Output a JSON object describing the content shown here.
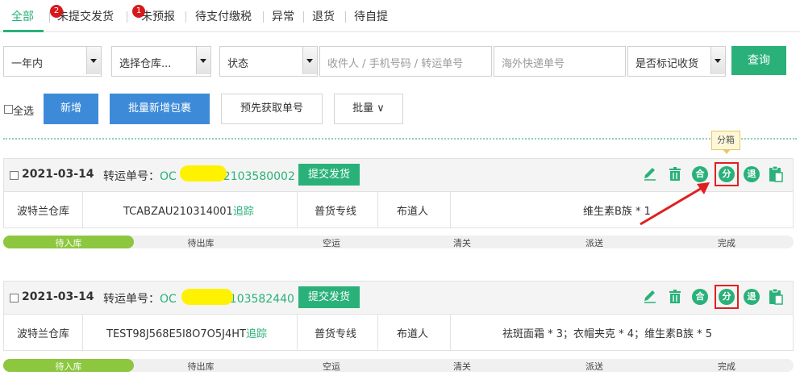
{
  "tabs": [
    {
      "label": "全部",
      "active": true
    },
    {
      "label": "未提交发货",
      "badge": "2"
    },
    {
      "label": "未预报",
      "badge": "1"
    },
    {
      "label": "待支付缴税"
    },
    {
      "label": "异常"
    },
    {
      "label": "退货"
    },
    {
      "label": "待自提"
    }
  ],
  "filters": {
    "time_range": "一年内",
    "warehouse": "选择仓库...",
    "status": "状态",
    "search_placeholder": "收件人 / 手机号码 / 转运单号",
    "overseas_placeholder": "海外快递单号",
    "marked_received": "是否标记收货",
    "query_label": "查询"
  },
  "actions": {
    "select_all": "全选",
    "add": "新增",
    "batch_add_package": "批量新增包裹",
    "prefetch_number": "预先获取单号",
    "batch": "批量 ∨"
  },
  "tooltip": "分箱",
  "accent_color": "#2ab17a",
  "stages": [
    "待入库",
    "待出库",
    "空运",
    "清关",
    "派送",
    "完成"
  ],
  "orders": [
    {
      "date": "2021-03-14",
      "tracking_label": "转运单号：",
      "tracking_prefix": "OC",
      "tracking_suffix": "2103580002",
      "submit": "提交发货",
      "warehouse": "波特兰仓库",
      "tracking_code": "TCABZAU210314001",
      "track_link": "追踪",
      "line": "普货专线",
      "brand": "布道人",
      "items": "维生素B族 * 1",
      "current_stage": "待入库",
      "stage_progress": 0.167,
      "icons": [
        "edit-icon",
        "delete-icon",
        "merge-icon",
        "split-icon",
        "return-icon",
        "clipboard-icon"
      ]
    },
    {
      "date": "2021-03-14",
      "tracking_label": "转运单号：",
      "tracking_prefix": "OC",
      "tracking_suffix": "103582440",
      "submit": "提交发货",
      "warehouse": "波特兰仓库",
      "tracking_code": "TEST98J568E5I8O7O5J4HT",
      "track_link": "追踪",
      "line": "普货专线",
      "brand": "布道人",
      "items": "祛斑面霜 * 3；衣帽夹克 * 4；维生素B族 * 5",
      "current_stage": "待入库",
      "stage_progress": 0.167,
      "icons": [
        "edit-icon",
        "delete-icon",
        "merge-icon",
        "split-icon",
        "return-icon",
        "clipboard-icon"
      ]
    }
  ],
  "icon_glyphs": {
    "merge": "合",
    "split": "分",
    "return": "退"
  }
}
